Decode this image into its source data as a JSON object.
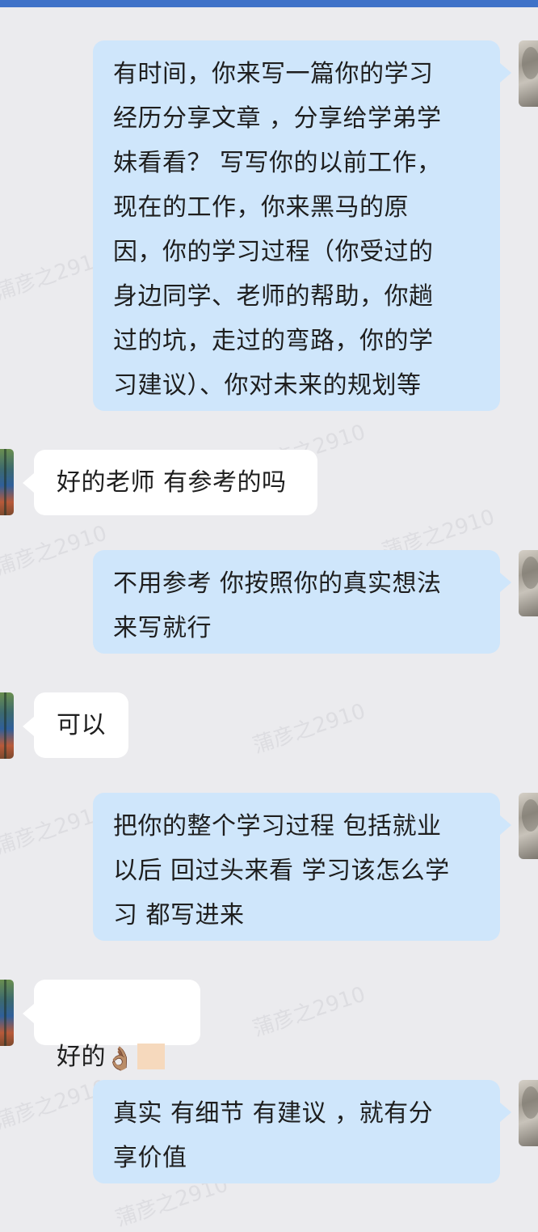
{
  "messages": [
    {
      "side": "out",
      "text": "有时间，你来写一篇你的学习\n经历分享文章 ，分享给学弟学\n妹看看？ 写写你的以前工作，\n现在的工作，你来黑马的原\n因，你的学习过程（你受过的\n身边同学、老师的帮助，你趟\n过的坑，走过的弯路，你的学\n习建议）、你对未来的规划等"
    },
    {
      "side": "in",
      "text": "好的老师 有参考的吗"
    },
    {
      "side": "out",
      "text": "不用参考  你按照你的真实想法\n来写就行"
    },
    {
      "side": "in",
      "text": "可以"
    },
    {
      "side": "out",
      "text": "把你的整个学习过程   包括就业\n以后  回过头来看 学习该怎么学\n习 都写进来"
    },
    {
      "side": "in",
      "text": "好的",
      "emoji": "👌🏽"
    },
    {
      "side": "out",
      "text": "真实  有细节  有建议  ，就有分\n享价值"
    }
  ],
  "watermark": {
    "text": "蒲彦之2910"
  },
  "colors": {
    "background": "#ebebee",
    "outgoing_bubble": "#cfe6fb",
    "incoming_bubble": "#ffffff",
    "top_bar": "#3f72c8"
  }
}
